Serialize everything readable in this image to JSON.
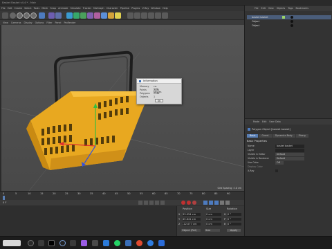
{
  "window": {
    "title": "Basket Basket v4.4 * - Main"
  },
  "menubar": [
    "File",
    "Edit",
    "Create",
    "Select",
    "Tools",
    "Mesh",
    "Snap",
    "Animate",
    "Simulate",
    "Tracker",
    "MoGraph",
    "Character",
    "Pipeline",
    "Plugins",
    "V-Ray",
    "Window",
    "Help"
  ],
  "viewport_menu": [
    "View",
    "Cameras",
    "Display",
    "Options",
    "Filter",
    "Panel",
    "ProRender"
  ],
  "viewport": {
    "grid_spacing": "Grid Spacing : 10 cm"
  },
  "dialog": {
    "title": "Information",
    "rows": [
      {
        "label": "Memory",
        "value": "ca. 172 KBytes"
      },
      {
        "label": "Points",
        "value": "2424"
      },
      {
        "label": "Polygons",
        "value": "2396"
      },
      {
        "label": "Objects",
        "value": "1"
      }
    ],
    "ok": "OK"
  },
  "object_manager": {
    "menu": [
      "File",
      "Edit",
      "View",
      "Objects",
      "Tags",
      "Bookmarks"
    ],
    "objects": [
      "basket basket",
      "Object",
      "Object"
    ]
  },
  "attributes": {
    "menu": [
      "Mode",
      "Edit",
      "User Data"
    ],
    "object_title": "Polygon Object [basket basket]",
    "tabs": [
      "Basic",
      "Coord.",
      "Dynamics Body",
      "Phong"
    ],
    "section": "Basic Properties",
    "props": [
      {
        "label": "Name",
        "value": "basket basket"
      },
      {
        "label": "Layer",
        "value": ""
      },
      {
        "label": "Visible in Editor",
        "value": "Default"
      },
      {
        "label": "Visible in Renderer",
        "value": "Default"
      },
      {
        "label": "Use Color",
        "value": "Off"
      },
      {
        "label": "Display Color",
        "value": ""
      },
      {
        "label": "X-Ray",
        "value": ""
      }
    ]
  },
  "timeline": {
    "ticks": [
      "0",
      "5",
      "10",
      "15",
      "20",
      "25",
      "30",
      "35",
      "40",
      "45",
      "50",
      "55",
      "60",
      "65",
      "70",
      "75",
      "80",
      "85",
      "90"
    ],
    "frame": "0 F"
  },
  "coordinates": {
    "headers": [
      "Position",
      "Size",
      "Rotation"
    ],
    "rows": [
      {
        "axis": "X",
        "pos": "33.054 cm",
        "size": "0 cm",
        "rot": "H",
        "rotv": "0 °"
      },
      {
        "axis": "Y",
        "pos": "45.641 cm",
        "size": "0 cm",
        "rot": "P",
        "rotv": "0 °"
      },
      {
        "axis": "Z",
        "pos": "-12.077 cm",
        "size": "0 cm",
        "rot": "B",
        "rotv": "0 °"
      }
    ],
    "mode": "Object (Rel)",
    "size_mode": "Size",
    "apply": "Apply"
  },
  "colors": {
    "basket": "#f0b020",
    "accent": "#5a7fb4"
  }
}
